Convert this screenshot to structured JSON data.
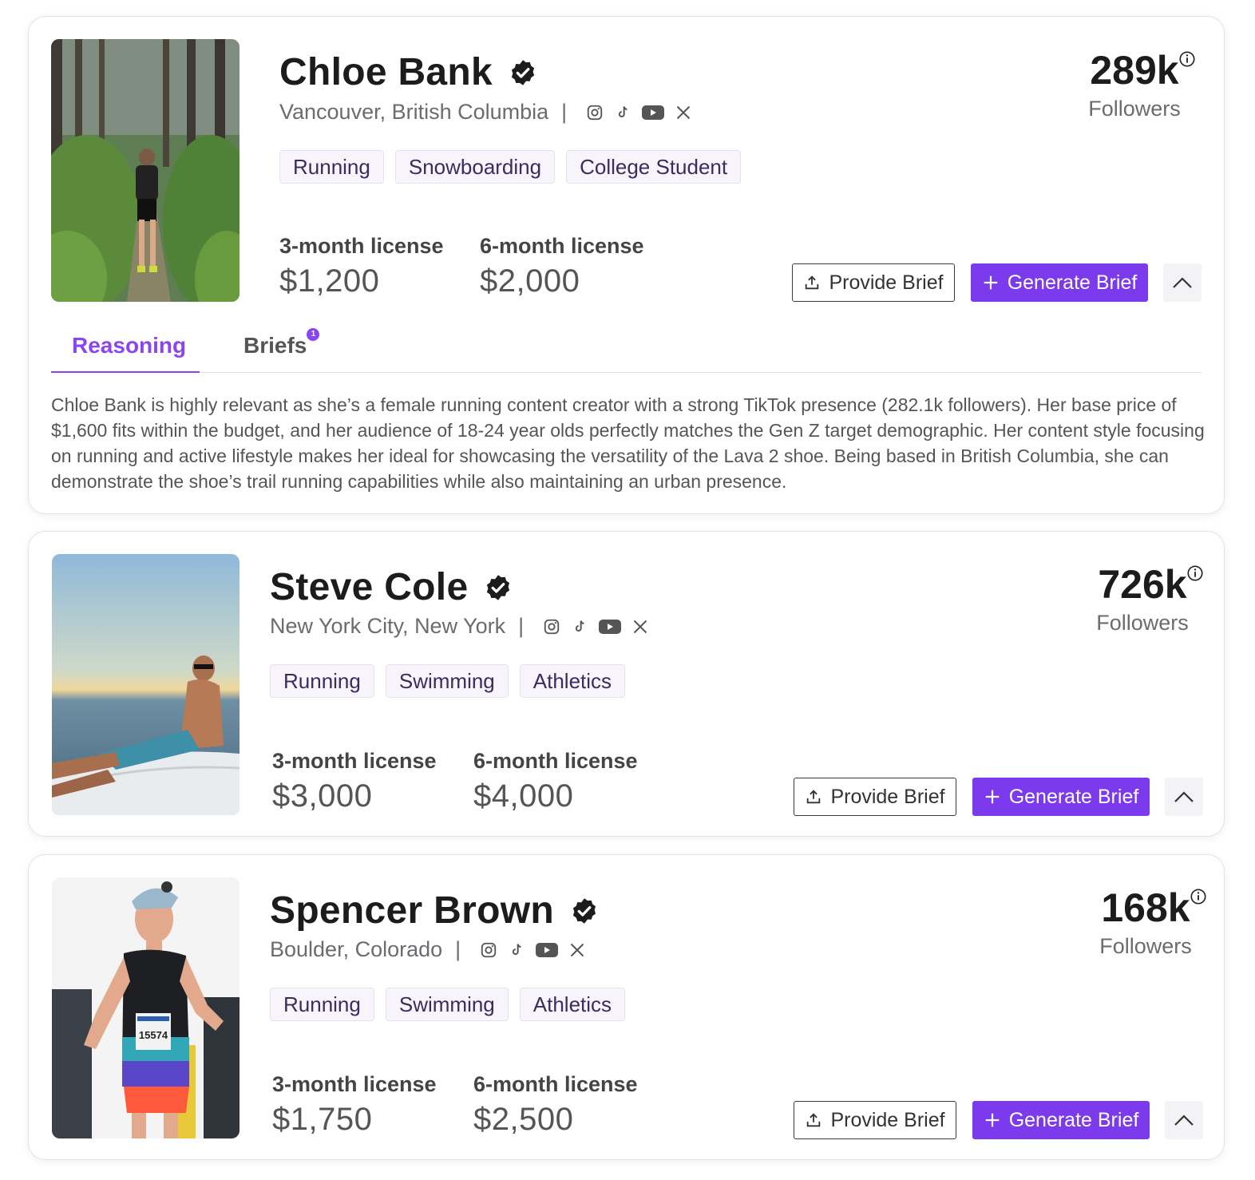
{
  "creators": [
    {
      "name": "Chloe Bank",
      "location": "Vancouver, British Columbia",
      "tags": [
        "Running",
        "Snowboarding",
        "College Student"
      ],
      "license_3_label": "3-month license",
      "license_3_price": "$1,200",
      "license_6_label": "6-month license",
      "license_6_price": "$2,000",
      "followers_count": "289k",
      "followers_label": "Followers",
      "photo": "runner-on-forest-trail"
    },
    {
      "name": "Steve Cole",
      "location": "New York City, New York",
      "tags": [
        "Running",
        "Swimming",
        "Athletics"
      ],
      "license_3_label": "3-month license",
      "license_3_price": "$3,000",
      "license_6_label": "6-month license",
      "license_6_price": "$4,000",
      "followers_count": "726k",
      "followers_label": "Followers",
      "photo": "man-on-boat-at-sunset"
    },
    {
      "name": "Spencer Brown",
      "location": "Boulder, Colorado",
      "tags": [
        "Running",
        "Swimming",
        "Athletics"
      ],
      "license_3_label": "3-month license",
      "license_3_price": "$1,750",
      "license_6_label": "6-month license",
      "license_6_price": "$2,500",
      "followers_count": "168k",
      "followers_label": "Followers",
      "photo": "marathon-runner-with-bib",
      "bib_number": "15574"
    }
  ],
  "buttons": {
    "provide_brief": "Provide Brief",
    "generate_brief": "Generate Brief"
  },
  "tabs": {
    "reasoning": "Reasoning",
    "briefs": "Briefs",
    "briefs_badge": "1"
  },
  "reasoning_text": "Chloe Bank is highly relevant as she’s a female running content creator with a strong TikTok presence (282.1k followers). Her base price of $1,600 fits within the budget, and her audience of 18-24 year olds perfectly matches the Gen Z target demographic. Her content style focusing on running and active lifestyle makes her ideal for showcasing the versatility of the Lava 2 shoe. Being based in British Columbia, she can demonstrate the shoe’s trail running capabilities while also maintaining an urban presence.",
  "social_icons": [
    "instagram-icon",
    "tiktok-icon",
    "youtube-icon",
    "x-icon"
  ],
  "colors": {
    "accent": "#7c3aed",
    "tab_active": "#8b45f0",
    "tag_bg": "#f7f5fb"
  }
}
